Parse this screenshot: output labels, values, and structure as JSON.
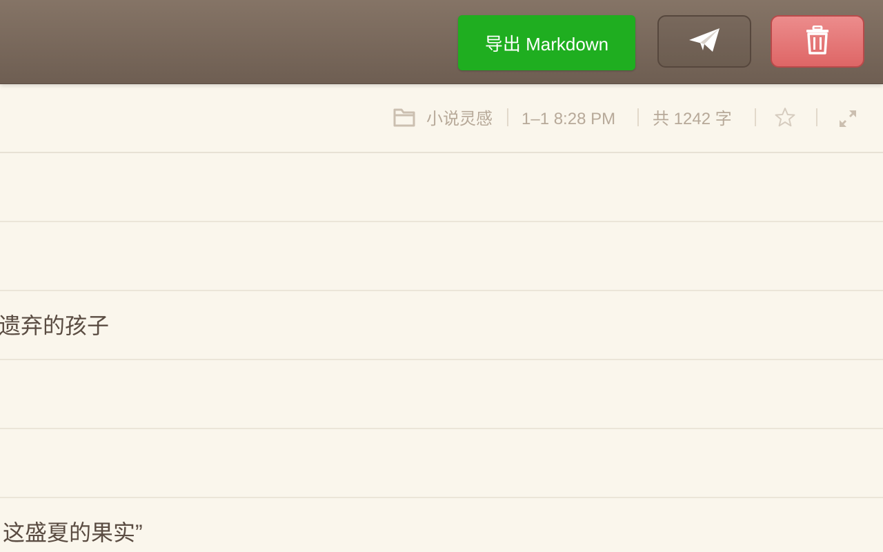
{
  "toolbar": {
    "export_label": "导出 Markdown",
    "send_icon": "paper-plane-icon",
    "delete_icon": "trash-icon"
  },
  "meta": {
    "folder_icon": "folder-icon",
    "folder_name": "小说灵感",
    "datetime": "1–1 8:28 PM",
    "word_count": "共 1242 字",
    "star_icon": "star-icon",
    "fullscreen_icon": "expand-icon"
  },
  "content": {
    "lines": [
      "",
      "",
      "遗弃的孩子",
      "",
      "",
      "这盛夏的果实”"
    ]
  },
  "colors": {
    "export_green": "#1fae20",
    "delete_red": "#e27171",
    "toolbar_brown": "#7a6a5d",
    "paper": "#faf6ec",
    "meta_text": "#b7a999"
  }
}
